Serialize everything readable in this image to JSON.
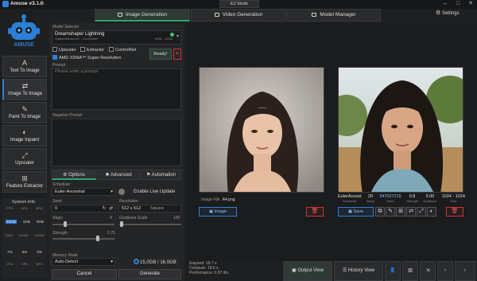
{
  "app": {
    "title": "Amuse v3.1.0",
    "version_tag": "beta",
    "mode": "EZ Mode"
  },
  "tabs": [
    {
      "label": "Image Generation"
    },
    {
      "label": "Video Generation"
    },
    {
      "label": "Model Manager"
    }
  ],
  "settings_label": "Settings",
  "nav": [
    {
      "label": "Text To Image",
      "icon": "A"
    },
    {
      "label": "Image To Image",
      "icon": "⇄"
    },
    {
      "label": "Paint To Image",
      "icon": "✎"
    },
    {
      "label": "Image Inpaint",
      "icon": "◐"
    },
    {
      "label": "Upscaler",
      "icon": "⤢"
    },
    {
      "label": "Feature Extractor",
      "icon": "⊞"
    }
  ],
  "sysinfo": {
    "title": "System Info",
    "labels_row1": [
      "FPS",
      "GPU",
      "NPU"
    ],
    "mem_row": [
      "21GB",
      "1GB",
      "0GB"
    ],
    "labels_row2": [
      "RAM",
      "VRAM",
      "VRAM"
    ],
    "pct_row": [
      "7%",
      "0%",
      "0%"
    ],
    "labels_row3": [
      "CPU",
      "GPU",
      "NPU"
    ]
  },
  "model": {
    "selector_label": "Model Selector",
    "name": "Dreamshaper Lightning",
    "sub": "StableDiffusionXL - ControlNet",
    "size": "6GB - 12GB",
    "upscaler_label": "Upscaler",
    "extractor_label": "Extractor",
    "controlnet_label": "ControlNet",
    "amd_label": "AMD XDNA™ Super Resolution",
    "ready_label": "Ready!",
    "ready_close": "✕"
  },
  "prompt": {
    "label": "Prompt",
    "placeholder": "Please enter a prompt."
  },
  "negative": {
    "label": "Negative Prompt"
  },
  "subtabs": [
    "Options",
    "Advanced",
    "Automation"
  ],
  "options": {
    "scheduler_label": "Scheduler",
    "scheduler_value": "Euler-Ancestral",
    "live_update_label": "Enable Live Update",
    "seed_label": "Seed",
    "seed_value": "0",
    "resolution_label": "Resolution",
    "resolution_value": "512 x 512",
    "resolution_mode": "Square",
    "steps_label": "Steps",
    "steps_max": "4",
    "guidance_label": "Guidance Scale",
    "guidance_max": "100",
    "strength_label": "Strength",
    "strength_value": "0.75",
    "memory_label": "Memory Mode",
    "memory_value": "Auto-Detect",
    "memory_usage": "15,0GB / 16,0GB"
  },
  "actions": {
    "cancel": "Cancel",
    "generate": "Generate"
  },
  "left_image": {
    "file_label": "Image File",
    "file_value": "A4.png",
    "image_button": "Image"
  },
  "right_image": {
    "scheduler": "EulerAncest",
    "scheduler_lbl": "Scheduler",
    "steps": "20",
    "steps_lbl": "Steps",
    "seed": "347027215",
    "seed_lbl": "Seed",
    "strength": "0.8",
    "strength_lbl": "Strength",
    "guidance": "3.00",
    "guidance_lbl": "Guidance",
    "size": "1024 - 1024",
    "size_lbl": "Size",
    "save_button": "Save"
  },
  "stats": {
    "elapsed": "Elapsed: 18.7 s",
    "compute": "Compute: 18.6 s",
    "performance": "Performance: 0.97 it/s"
  },
  "bottom": {
    "output_view": "Output View",
    "history_view": "History View"
  },
  "colors": {
    "accent_blue": "#2f7fd8",
    "accent_green": "#2fa46a",
    "danger": "#cc3333",
    "background": "#1e1f21"
  }
}
